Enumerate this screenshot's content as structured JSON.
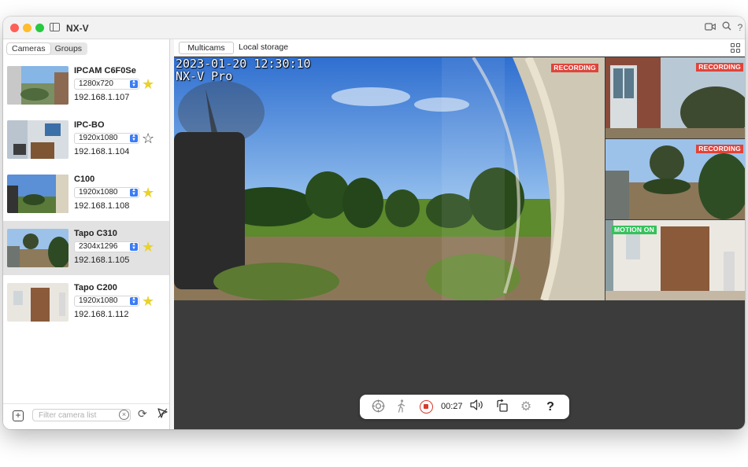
{
  "window": {
    "title": "NX-V"
  },
  "sidebar": {
    "segments": [
      "Cameras",
      "Groups"
    ],
    "active_segment": "Cameras",
    "cameras": [
      {
        "name": "IPCAM C6F0Se",
        "resolution": "1280x720",
        "ip": "192.168.1.107",
        "favorite": true,
        "selected": false
      },
      {
        "name": "IPC-BO",
        "resolution": "1920x1080",
        "ip": "192.168.1.104",
        "favorite": false,
        "selected": false
      },
      {
        "name": "C100",
        "resolution": "1920x1080",
        "ip": "192.168.1.108",
        "favorite": true,
        "selected": false
      },
      {
        "name": "Tapo C310",
        "resolution": "2304x1296",
        "ip": "192.168.1.105",
        "favorite": true,
        "selected": true
      },
      {
        "name": "Tapo C200",
        "resolution": "1920x1080",
        "ip": "192.168.1.112",
        "favorite": true,
        "selected": false
      }
    ],
    "filter_placeholder": "Filter camera list"
  },
  "main": {
    "tabs": [
      "Multicams",
      "Local storage"
    ],
    "active_tab": "Multicams",
    "feeds": {
      "main": {
        "osd_datetime": "2023-01-20 12:30:10",
        "osd_label": "NX-V Pro",
        "badge": "RECORDING"
      },
      "feed1": {
        "badge": "RECORDING"
      },
      "feed2": {
        "badge": "RECORDING"
      },
      "feed3": {
        "badge": "MOTION ON"
      }
    },
    "controls": {
      "elapsed": "00:27"
    }
  },
  "colors": {
    "recording": "#e0443b",
    "motion": "#36c15d",
    "star": "#e8d22c",
    "accent": "#3a7bf6"
  }
}
